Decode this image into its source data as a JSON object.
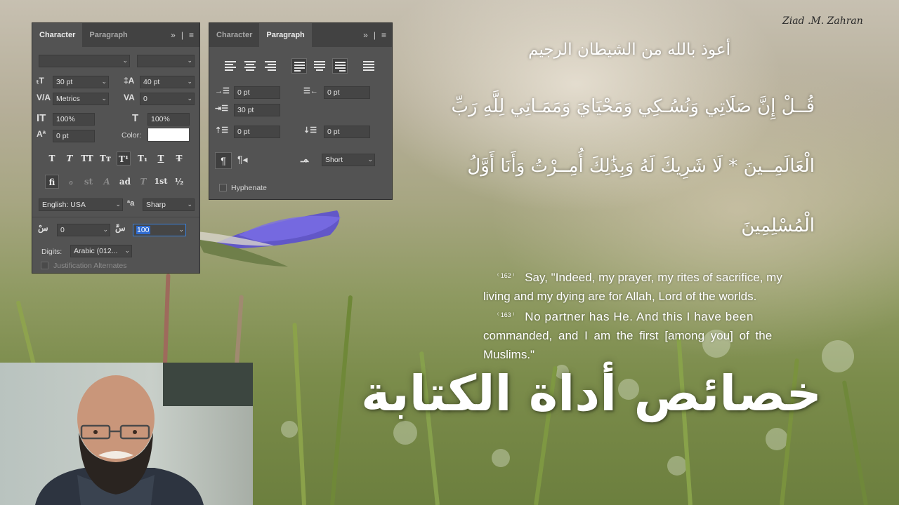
{
  "watermark": "Ziad .M. Zahran",
  "character_panel": {
    "tabs": [
      "Character",
      "Paragraph"
    ],
    "font_size": "30 pt",
    "leading": "40 pt",
    "kerning": "Metrics",
    "tracking": "0",
    "vertical_scale": "100%",
    "horizontal_scale": "100%",
    "baseline_shift": "0 pt",
    "color_label": "Color:",
    "style_buttons": [
      "T",
      "T",
      "TT",
      "Tᴛ",
      "T¹",
      "T₁",
      "T",
      "T"
    ],
    "opentype_buttons": [
      "ﬁ",
      "ℴ",
      "st",
      "A",
      "ad",
      "T",
      "1st",
      "½"
    ],
    "language": "English: USA",
    "aa_icon": "ªa",
    "antialias": "Sharp",
    "field_left": "0",
    "field_right": "100",
    "digits_label": "Digits:",
    "digits_value": "Arabic (012...",
    "justification_alternates": "Justification Alternates"
  },
  "paragraph_panel": {
    "tabs": [
      "Character",
      "Paragraph"
    ],
    "indent_left": "0 pt",
    "indent_right": "0 pt",
    "indent_first": "30 pt",
    "space_before": "0 pt",
    "space_after": "0 pt",
    "kashida": "Short",
    "hyphenate_label": "Hyphenate"
  },
  "content": {
    "isti3adha": "أعوذ بالله من الشيطان الرجيم",
    "verse_line1": "قُــلْ إِنَّ صَلَاتِي وَنُسُـكِي وَمَحْيَايَ وَمَمَـاتِي لِلَّهِ رَبِّ",
    "verse_line2": "الْعَالَمِــينَ *  لَا شَرِيكَ لَهُ  وَبِذَٰلِكَ أُمِــرْتُ وَأَنَا أَوَّلُ",
    "verse_line3": "الْمُسْلِمِينَ",
    "ref1": "162",
    "translation1a": "Say, \"Indeed, my prayer, my rites of sacrifice, my",
    "translation1b": "living and my dying are for Allah, Lord of the worlds.",
    "ref2": "163",
    "translation2a": "No partner has He. And this I have been",
    "translation2b": "commanded, and I am the first [among you] of the",
    "translation2c": "Muslims.\"",
    "title": "خصائص أداة الكتابة"
  },
  "colors": {
    "panel_bg": "#535353",
    "field_bg": "#454545",
    "text_white": "#ffffff",
    "flower": "#5b4fd0"
  }
}
